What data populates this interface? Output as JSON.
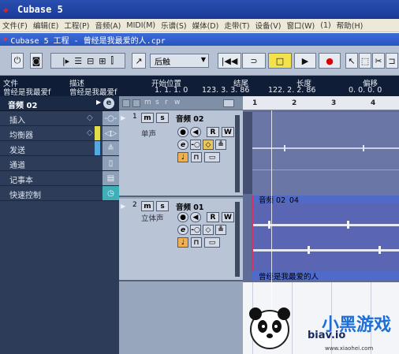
{
  "window": {
    "title": "Cubase 5"
  },
  "menu": [
    "文件(F)",
    "编辑(E)",
    "工程(P)",
    "音频(A)",
    "MIDI(M)",
    "乐谱(S)",
    "媒体(D)",
    "走带(T)",
    "设备(V)",
    "窗口(W)",
    "(1)",
    "帮助(H)"
  ],
  "document": {
    "title": "Cubase 5 工程 - 曾经是我最爱的人.cpr"
  },
  "toolbar": {
    "mode": "后触"
  },
  "infoline": {
    "headers": [
      "文件",
      "描述",
      "开始位置",
      "结尾",
      "长度",
      "偏移"
    ],
    "values": [
      "曾经是我最爱f",
      "曾经是我最爱f",
      "1. 1. 1.  0",
      "123. 3. 3. 86",
      "122. 2. 2. 86",
      "0. 0. 0.  0"
    ]
  },
  "inspector": {
    "track_name": "音频 02",
    "sections": [
      "插入",
      "均衡器",
      "发送",
      "通道",
      "记事本",
      "快速控制"
    ]
  },
  "tracks": [
    {
      "number": "1",
      "name": "音频 02",
      "sub": "单声",
      "m": "m",
      "s": "s",
      "r": "R",
      "w": "W"
    },
    {
      "number": "2",
      "name": "音频 01",
      "sub": "立体声",
      "m": "m",
      "s": "s",
      "r": "R",
      "w": "W"
    }
  ],
  "ruler": [
    "1",
    "2",
    "3",
    "4"
  ],
  "parts": {
    "event1": "音频 02_04",
    "event2": "曾经是我最爱的人"
  },
  "watermark": {
    "site": "www.xiaohei.com",
    "brand": "小黑游戏",
    "partial": "biav.io"
  },
  "colors": {
    "track_bg": "#b9c5d6",
    "inspector_bg": "#2d3c58",
    "arrange_bg": "#5f6c95"
  }
}
